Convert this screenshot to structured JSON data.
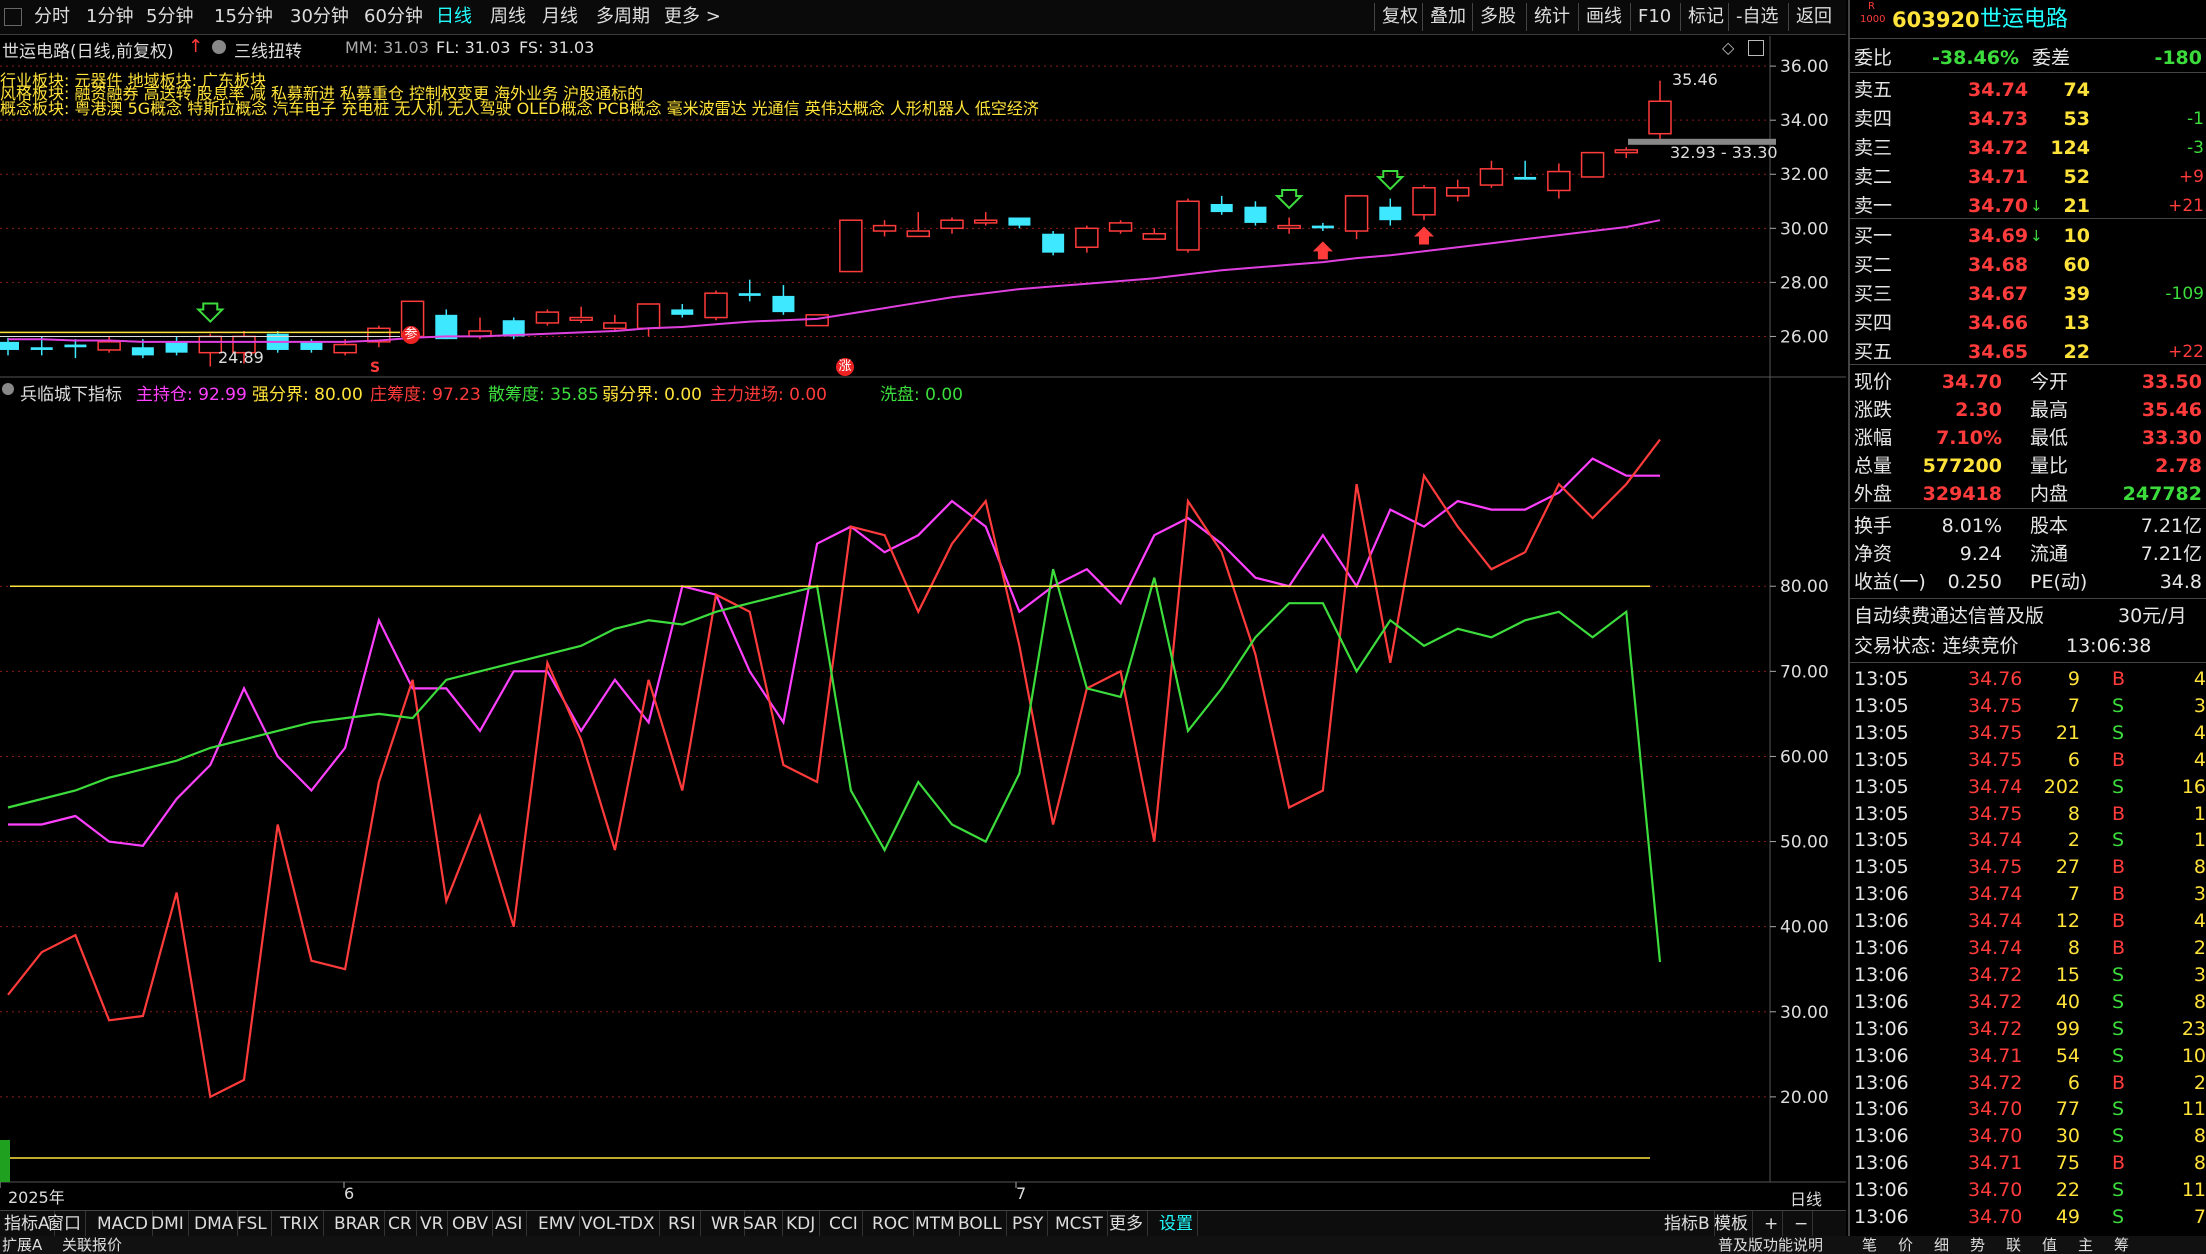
{
  "toolbar": {
    "periods": [
      "分时",
      "1分钟",
      "5分钟",
      "15分钟",
      "30分钟",
      "60分钟",
      "日线",
      "周线",
      "月线",
      "多周期",
      "更多 >"
    ],
    "active_period": "日线",
    "right_buttons": [
      "复权",
      "叠加",
      "多股",
      "统计",
      "画线",
      "F10",
      "标记",
      "-自选",
      "返回"
    ]
  },
  "chart_header": {
    "title": "世运电路(日线,前复权)",
    "indicator": "三线扭转",
    "mm": "MM: 31.03",
    "fl": "FL: 31.03",
    "fs": "FS: 31.03"
  },
  "chart_notes": {
    "line1": "行业板块: 元器件        地域板块: 广东板块",
    "line2": "风格板块: 融资融券 高送转 股息率 减 私募新进 私募重仓 控制权变更 海外业务 沪股通标的",
    "line3": "概念板块: 粤港澳 5G概念 特斯拉概念 汽车电子 充电桩 无人机 无人驾驶 OLED概念 PCB概念 毫米波雷达 光通信 英伟达概念 人形机器人 低空经济"
  },
  "price_axis": [
    "36.00",
    "34.00",
    "32.00",
    "30.00",
    "28.00",
    "26.00"
  ],
  "price_annotations": {
    "high": "35.46",
    "low": "24.89",
    "range": "32.93 - 33.30"
  },
  "markers": {
    "s": "S",
    "can": "参",
    "zhang": "涨"
  },
  "indicator_header": {
    "name": "兵临城下指标",
    "items": [
      {
        "label": "主持仓: ",
        "value": "92.99",
        "color": "#ff40ff"
      },
      {
        "label": "强分界: ",
        "value": "80.00",
        "color": "#ffe23a"
      },
      {
        "label": "庄筹度: ",
        "value": "97.23",
        "color": "#ff3b3b"
      },
      {
        "label": "散筹度: ",
        "value": "35.85",
        "color": "#3cdc3c"
      },
      {
        "label": "弱分界: ",
        "value": "0.00",
        "color": "#ffe23a"
      },
      {
        "label": "主力进场: ",
        "value": "0.00",
        "color": "#ff3b3b"
      },
      {
        "label": "洗盘: ",
        "value": "0.00",
        "color": "#3cdc3c"
      }
    ]
  },
  "indicator_axis": [
    "80.00",
    "70.00",
    "60.00",
    "50.00",
    "40.00",
    "30.00",
    "20.00"
  ],
  "date_axis": {
    "year": "2025年",
    "m6": "6",
    "m7": "7"
  },
  "period_label": "日线",
  "bottom_tabs": [
    "指标A",
    "窗口",
    "MACD",
    "DMI",
    "DMA",
    "FSL",
    "TRIX",
    "BRAR",
    "CR",
    "VR",
    "OBV",
    "ASI",
    "EMV",
    "VOL-TDX",
    "RSI",
    "WR",
    "SAR",
    "KDJ",
    "CCI",
    "ROC",
    "MTM",
    "BOLL",
    "PSY",
    "MCST",
    "更多",
    "设置"
  ],
  "bottom_right_tabs": [
    "指标B",
    "模板",
    "+",
    "−"
  ],
  "chart_data": {
    "type": "line",
    "candles": {
      "ylim": [
        24.5,
        36.3
      ],
      "ohlc": [
        [
          25.8,
          25.95,
          25.3,
          25.5
        ],
        [
          25.6,
          26.0,
          25.3,
          25.5
        ],
        [
          25.7,
          25.9,
          25.2,
          25.6
        ],
        [
          25.5,
          26.0,
          25.4,
          25.8
        ],
        [
          25.6,
          25.9,
          25.2,
          25.3
        ],
        [
          25.8,
          26.0,
          25.3,
          25.4
        ],
        [
          25.4,
          26.1,
          24.89,
          26.0
        ],
        [
          25.4,
          26.2,
          25.0,
          26.0
        ],
        [
          26.1,
          26.2,
          25.4,
          25.5
        ],
        [
          25.8,
          25.9,
          25.4,
          25.5
        ],
        [
          25.4,
          25.9,
          25.3,
          25.7
        ],
        [
          25.8,
          26.4,
          25.6,
          26.3
        ],
        [
          26.0,
          27.3,
          25.9,
          27.3
        ],
        [
          26.8,
          27.0,
          25.9,
          25.9
        ],
        [
          26.0,
          26.7,
          25.9,
          26.2
        ],
        [
          26.6,
          26.7,
          25.9,
          26.0
        ],
        [
          26.5,
          27.0,
          26.4,
          26.9
        ],
        [
          26.6,
          27.1,
          26.5,
          26.7
        ],
        [
          26.3,
          26.8,
          26.2,
          26.5
        ],
        [
          26.3,
          27.2,
          26.0,
          27.2
        ],
        [
          27.0,
          27.2,
          26.7,
          26.8
        ],
        [
          26.7,
          27.7,
          26.6,
          27.6
        ],
        [
          27.6,
          28.1,
          27.3,
          27.5
        ],
        [
          27.5,
          27.9,
          26.8,
          26.9
        ],
        [
          26.4,
          26.8,
          26.4,
          26.8
        ],
        [
          28.4,
          30.3,
          28.4,
          30.3
        ],
        [
          29.9,
          30.3,
          29.7,
          30.1
        ],
        [
          29.7,
          30.6,
          29.7,
          29.9
        ],
        [
          30.0,
          30.4,
          29.8,
          30.3
        ],
        [
          30.2,
          30.6,
          30.1,
          30.3
        ],
        [
          30.4,
          30.4,
          30.0,
          30.1
        ],
        [
          29.8,
          29.9,
          29.0,
          29.1
        ],
        [
          29.3,
          30.1,
          29.1,
          30.0
        ],
        [
          29.9,
          30.3,
          29.8,
          30.2
        ],
        [
          29.6,
          30.0,
          29.6,
          29.8
        ],
        [
          29.2,
          31.1,
          29.1,
          31.0
        ],
        [
          30.9,
          31.2,
          30.5,
          30.6
        ],
        [
          30.8,
          31.0,
          30.1,
          30.2
        ],
        [
          30.0,
          30.4,
          29.8,
          30.1
        ],
        [
          30.1,
          30.2,
          29.9,
          30.0
        ],
        [
          29.9,
          31.2,
          29.6,
          31.2
        ],
        [
          30.8,
          31.1,
          30.1,
          30.3
        ],
        [
          30.5,
          31.6,
          30.3,
          31.5
        ],
        [
          31.2,
          31.8,
          31.0,
          31.5
        ],
        [
          31.6,
          32.5,
          31.5,
          32.2
        ],
        [
          31.9,
          32.5,
          31.8,
          31.8
        ],
        [
          31.4,
          32.4,
          31.1,
          32.1
        ],
        [
          31.9,
          32.8,
          31.9,
          32.8
        ],
        [
          32.8,
          33.0,
          32.6,
          32.9
        ],
        [
          33.5,
          35.46,
          33.3,
          34.7
        ]
      ],
      "ma": [
        25.9,
        25.9,
        25.85,
        25.85,
        25.8,
        25.8,
        25.8,
        25.8,
        25.8,
        25.8,
        25.8,
        25.85,
        25.95,
        26.0,
        26.0,
        26.05,
        26.1,
        26.15,
        26.2,
        26.3,
        26.35,
        26.45,
        26.55,
        26.6,
        26.65,
        26.85,
        27.05,
        27.25,
        27.45,
        27.6,
        27.75,
        27.85,
        27.95,
        28.05,
        28.15,
        28.3,
        28.45,
        28.55,
        28.65,
        28.75,
        28.9,
        29.0,
        29.15,
        29.3,
        29.45,
        29.6,
        29.75,
        29.9,
        30.05,
        30.3
      ]
    },
    "indicator": {
      "ylim": [
        10,
        100
      ],
      "series": [
        {
          "name": "主持仓",
          "color": "#ff40ff",
          "values": [
            52,
            52,
            53,
            50,
            49.5,
            55,
            59,
            68,
            60,
            56,
            61,
            76,
            68,
            68,
            63,
            70,
            70,
            63,
            69,
            64,
            80,
            79,
            70,
            64,
            85,
            87,
            84,
            86,
            90,
            87,
            77,
            80,
            82,
            78,
            86,
            88,
            85,
            81,
            80,
            86,
            80,
            89,
            87,
            90,
            89,
            89,
            91,
            95,
            93,
            92.99
          ]
        },
        {
          "name": "庄筹度",
          "color": "#ff3b3b",
          "values": [
            32,
            37,
            39,
            29,
            29.5,
            44,
            20,
            22,
            52,
            36,
            35,
            57,
            69,
            43,
            53,
            40,
            71,
            62,
            49,
            69,
            56,
            79,
            77,
            59,
            57,
            87,
            86,
            77,
            85,
            90,
            73,
            52,
            68,
            70,
            50,
            90,
            84,
            72,
            54,
            56,
            92,
            71,
            93,
            87,
            82,
            84,
            92,
            88,
            92,
            97.23
          ]
        },
        {
          "name": "散筹度",
          "color": "#3cdc3c",
          "values": [
            54,
            55,
            56,
            57.5,
            58.5,
            59.5,
            61,
            62,
            63,
            64,
            64.5,
            65,
            64.5,
            69,
            70,
            71,
            72,
            73,
            75,
            76,
            75.5,
            77,
            78,
            79,
            80,
            56,
            49,
            57,
            52,
            50,
            58,
            82,
            68,
            67,
            81,
            63,
            68,
            74,
            78,
            78,
            70,
            76,
            73,
            75,
            74,
            76,
            77,
            74,
            77,
            35.85
          ]
        },
        {
          "name": "强分界",
          "color": "#ffe23a",
          "values": [
            80
          ]
        },
        {
          "name": "弱分界",
          "color": "#ffe23a",
          "values": [
            0
          ]
        }
      ]
    }
  },
  "quote": {
    "code": "603920",
    "name": "世运电路",
    "badge_top": "R",
    "badge_bottom": "1000",
    "weibi_label": "委比",
    "weibi_value": "-38.46%",
    "weicha_label": "委差",
    "weicha_value": "-180",
    "asks": [
      {
        "label": "卖五",
        "price": "34.74",
        "vol": "74",
        "chg": ""
      },
      {
        "label": "卖四",
        "price": "34.73",
        "vol": "53",
        "chg": "-1"
      },
      {
        "label": "卖三",
        "price": "34.72",
        "vol": "124",
        "chg": "-3"
      },
      {
        "label": "卖二",
        "price": "34.71",
        "vol": "52",
        "chg": "+9"
      },
      {
        "label": "卖一",
        "price": "34.70",
        "vol": "21",
        "chg": "+21",
        "arrow": "↓"
      }
    ],
    "bids": [
      {
        "label": "买一",
        "price": "34.69",
        "vol": "10",
        "chg": "",
        "arrow": "↓"
      },
      {
        "label": "买二",
        "price": "34.68",
        "vol": "60",
        "chg": ""
      },
      {
        "label": "买三",
        "price": "34.67",
        "vol": "39",
        "chg": "-109"
      },
      {
        "label": "买四",
        "price": "34.66",
        "vol": "13",
        "chg": ""
      },
      {
        "label": "买五",
        "price": "34.65",
        "vol": "22",
        "chg": "+22"
      }
    ],
    "stats": [
      {
        "l1": "现价",
        "v1": "34.70",
        "c1": "red",
        "l2": "今开",
        "v2": "33.50",
        "c2": "red"
      },
      {
        "l1": "涨跌",
        "v1": "2.30",
        "c1": "red",
        "l2": "最高",
        "v2": "35.46",
        "c2": "red"
      },
      {
        "l1": "涨幅",
        "v1": "7.10%",
        "c1": "red",
        "l2": "最低",
        "v2": "33.30",
        "c2": "red"
      },
      {
        "l1": "总量",
        "v1": "577200",
        "c1": "yellow",
        "l2": "量比",
        "v2": "2.78",
        "c2": "red"
      },
      {
        "l1": "外盘",
        "v1": "329418",
        "c1": "red",
        "l2": "内盘",
        "v2": "247782",
        "c2": "green"
      }
    ],
    "stats2": [
      {
        "l1": "换手",
        "v1": "8.01%",
        "l2": "股本",
        "v2": "7.21亿"
      },
      {
        "l1": "净资",
        "v1": "9.24",
        "l2": "流通",
        "v2": "7.21亿"
      },
      {
        "l1": "收益(一)",
        "v1": "0.250",
        "l2": "PE(动)",
        "v2": "34.8"
      }
    ],
    "promo": "自动续费通达信普及版",
    "promo_price": "30元/月",
    "status_label": "交易状态: 连续竞价",
    "status_time": "13:06:38"
  },
  "ticks": [
    {
      "t": "13:05",
      "p": "34.76",
      "v": "9",
      "s": "B",
      "n": "4"
    },
    {
      "t": "13:05",
      "p": "34.75",
      "v": "7",
      "s": "S",
      "n": "3"
    },
    {
      "t": "13:05",
      "p": "34.75",
      "v": "21",
      "s": "S",
      "n": "4"
    },
    {
      "t": "13:05",
      "p": "34.75",
      "v": "6",
      "s": "B",
      "n": "4"
    },
    {
      "t": "13:05",
      "p": "34.74",
      "v": "202",
      "s": "S",
      "n": "16"
    },
    {
      "t": "13:05",
      "p": "34.75",
      "v": "8",
      "s": "B",
      "n": "1"
    },
    {
      "t": "13:05",
      "p": "34.74",
      "v": "2",
      "s": "S",
      "n": "1"
    },
    {
      "t": "13:05",
      "p": "34.75",
      "v": "27",
      "s": "B",
      "n": "8"
    },
    {
      "t": "13:06",
      "p": "34.74",
      "v": "7",
      "s": "B",
      "n": "3"
    },
    {
      "t": "13:06",
      "p": "34.74",
      "v": "12",
      "s": "B",
      "n": "4"
    },
    {
      "t": "13:06",
      "p": "34.74",
      "v": "8",
      "s": "B",
      "n": "2"
    },
    {
      "t": "13:06",
      "p": "34.72",
      "v": "15",
      "s": "S",
      "n": "3"
    },
    {
      "t": "13:06",
      "p": "34.72",
      "v": "40",
      "s": "S",
      "n": "8"
    },
    {
      "t": "13:06",
      "p": "34.72",
      "v": "99",
      "s": "S",
      "n": "23"
    },
    {
      "t": "13:06",
      "p": "34.71",
      "v": "54",
      "s": "S",
      "n": "10"
    },
    {
      "t": "13:06",
      "p": "34.72",
      "v": "6",
      "s": "B",
      "n": "2"
    },
    {
      "t": "13:06",
      "p": "34.70",
      "v": "77",
      "s": "S",
      "n": "11"
    },
    {
      "t": "13:06",
      "p": "34.70",
      "v": "30",
      "s": "S",
      "n": "8"
    },
    {
      "t": "13:06",
      "p": "34.71",
      "v": "75",
      "s": "B",
      "n": "8"
    },
    {
      "t": "13:06",
      "p": "34.70",
      "v": "22",
      "s": "S",
      "n": "11"
    },
    {
      "t": "13:06",
      "p": "34.70",
      "v": "49",
      "s": "S",
      "n": "7"
    }
  ],
  "bottom_left": [
    "扩展A",
    "关联报价"
  ],
  "bottom_right": [
    "普及版功能说明",
    "笔",
    "价",
    "细",
    "势",
    "联",
    "值",
    "主",
    "筹"
  ]
}
